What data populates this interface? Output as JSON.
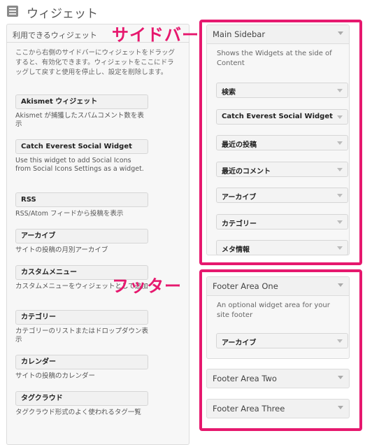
{
  "header": {
    "title": "ウィジェット"
  },
  "available": {
    "title": "利用できるウィジェット",
    "description": "ここから右側のサイドバーにウィジェットをドラッグすると、有効化できます。ウィジェットをここにドラッグして戻すと使用を停止し、設定を削除します。",
    "widgets": [
      {
        "label": "Akismet ウィジェット",
        "desc": "Akismet が捕獲したスパムコメント数を表示"
      },
      {
        "label": "Catch Everest Social Widget",
        "desc": "Use this widget to add Social Icons from Social Icons Settings as a widget."
      },
      {
        "label": "RSS",
        "desc": "RSS/Atom フィードから投稿を表示"
      },
      {
        "label": "アーカイブ",
        "desc": "サイトの投稿の月別アーカイブ"
      },
      {
        "label": "カスタムメニュー",
        "desc": "カスタムメニューをウィジェットとして追加"
      },
      {
        "label": "カテゴリー",
        "desc": "カテゴリーのリストまたはドロップダウン表示"
      },
      {
        "label": "カレンダー",
        "desc": "サイトの投稿のカレンダー"
      },
      {
        "label": "タグクラウド",
        "desc": "タグクラウド形式のよく使われるタグ一覧"
      }
    ]
  },
  "sidebar_area": {
    "title": "Main Sidebar",
    "description": "Shows the Widgets at the side of Content",
    "items": [
      "検索",
      "Catch Everest Social Widget",
      "最近の投稿",
      "最近のコメント",
      "アーカイブ",
      "カテゴリー",
      "メタ情報"
    ]
  },
  "footer_one": {
    "title": "Footer Area One",
    "description": "An optional widget area for your site footer",
    "items": [
      "アーカイブ"
    ]
  },
  "footer_two": {
    "title": "Footer Area Two"
  },
  "footer_three": {
    "title": "Footer Area Three"
  },
  "annotations": {
    "sidebar": "サイドバー",
    "footer": "フッター"
  },
  "colors": {
    "highlight": "#e6186e"
  }
}
